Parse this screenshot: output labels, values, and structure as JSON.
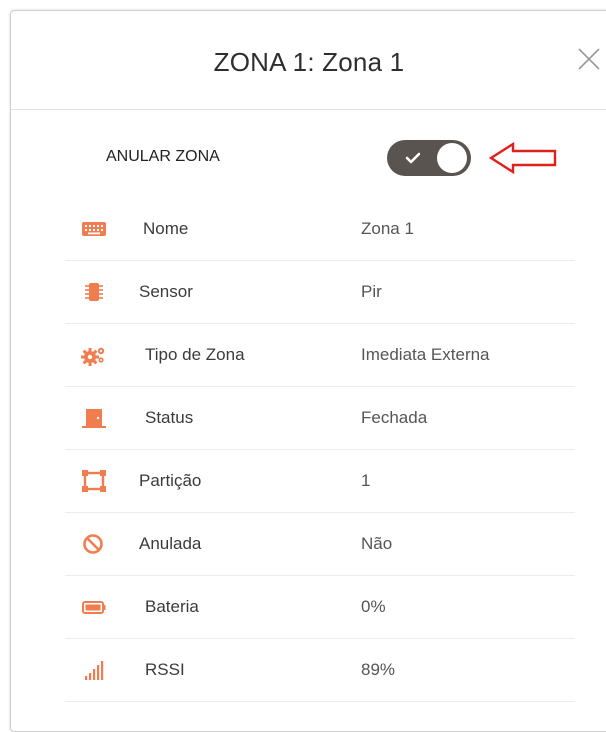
{
  "modal": {
    "title": "ZONA 1: Zona 1",
    "close_icon": "close-icon"
  },
  "toggle": {
    "label": "ANULAR ZONA",
    "state": "on",
    "color": "#5a5450"
  },
  "annotation": {
    "arrow_icon": "red-arrow-left-icon",
    "color": "#e0201a"
  },
  "accent_color": "#f07d4f",
  "properties": [
    {
      "label": "Nome",
      "value": "Zona 1",
      "icon": "keyboard-icon"
    },
    {
      "label": "Sensor",
      "value": "Pir",
      "icon": "sensor-chip-icon"
    },
    {
      "label": "Tipo de Zona",
      "value": "Imediata Externa",
      "icon": "gears-icon"
    },
    {
      "label": "Status",
      "value": "Fechada",
      "icon": "door-icon"
    },
    {
      "label": "Partição",
      "value": "1",
      "icon": "partition-icon"
    },
    {
      "label": "Anulada",
      "value": "Não",
      "icon": "prohibited-icon"
    },
    {
      "label": "Bateria",
      "value": "0%",
      "icon": "battery-icon"
    },
    {
      "label": "RSSI",
      "value": "89%",
      "icon": "signal-icon"
    }
  ]
}
